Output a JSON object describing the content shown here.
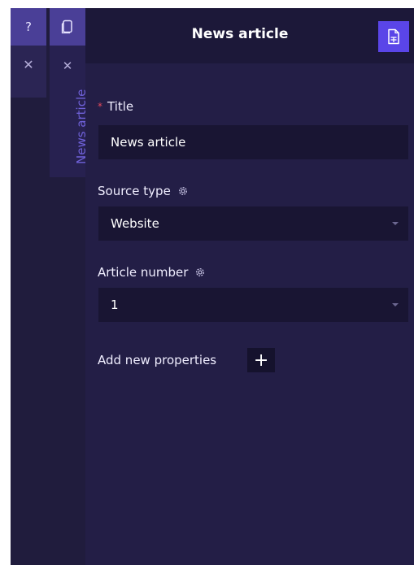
{
  "rail": {
    "help_label": "?",
    "close_label": "✕",
    "tab_close_label": "✕",
    "tab_label": "News article"
  },
  "header": {
    "title": "News article"
  },
  "form": {
    "title_field": {
      "required_mark": "*",
      "label": "Title",
      "value": "News article"
    },
    "source_type_field": {
      "label": "Source type",
      "value": "Website"
    },
    "article_number_field": {
      "label": "Article number",
      "value": "1"
    },
    "add_properties": {
      "label": "Add new properties",
      "button_label": "+"
    }
  },
  "colors": {
    "accent": "#5a45e8",
    "rail_active": "#4a3f97",
    "background": "#231e46",
    "required": "#e44a5b"
  },
  "icons": {
    "copy": "copy-icon",
    "document": "document-icon",
    "gear": "gear-icon",
    "dropdown": "chevron-down-icon"
  }
}
